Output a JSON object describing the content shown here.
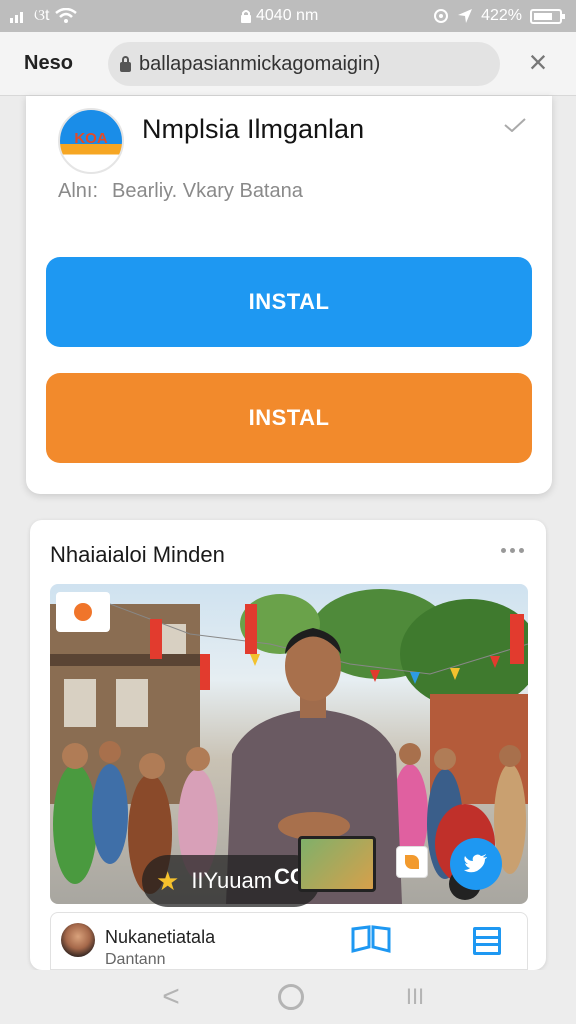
{
  "status_bar": {
    "signal_text": "ଓt",
    "time": "4040 nm",
    "battery": "422%",
    "icons": [
      "signal-icon",
      "wifi-icon",
      "lock-icon",
      "location-icon",
      "navigation-icon",
      "battery-icon"
    ]
  },
  "browser": {
    "site_name": "Neso",
    "url": "ballapasianmickagomaigin)",
    "close_label": "×"
  },
  "app": {
    "logo_text": "KOA",
    "name": "Nmplsia Ilmganlan",
    "meta_left": "Alnı:",
    "meta_right": "Bearliy. Vkary Batana",
    "install_primary": "INSTAL",
    "install_secondary": "INSTAL",
    "colors": {
      "primary": "#1e98f2",
      "secondary": "#f28a2c"
    }
  },
  "post": {
    "title": "Nhaiaialoi Minden",
    "badge_label": "IIYuuam",
    "photo_text": "CO",
    "author": "Nukanetiatala",
    "sub": "Dantann"
  },
  "nav": {
    "back": "<",
    "recent": "III"
  }
}
